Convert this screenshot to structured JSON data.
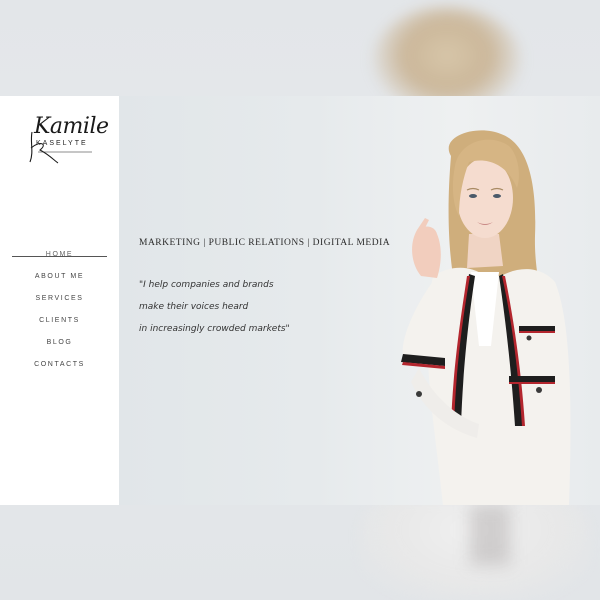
{
  "brand": {
    "script_name": "Kamile",
    "surname": "KASELYTE"
  },
  "nav": {
    "items": [
      {
        "label": "HOME",
        "active": true
      },
      {
        "label": "ABOUT ME",
        "active": false
      },
      {
        "label": "SERVICES",
        "active": false
      },
      {
        "label": "CLIENTS",
        "active": false
      },
      {
        "label": "BLOG",
        "active": false
      },
      {
        "label": "CONTACTS",
        "active": false
      }
    ]
  },
  "hero": {
    "tagline": "MARKETING | PUBLIC RELATIONS | DIGITAL MEDIA",
    "quote_lines": [
      "\"I help companies and brands",
      "make their voices heard",
      "in increasingly crowded markets\""
    ]
  },
  "colors": {
    "sidebar_bg": "#ffffff",
    "hero_bg": "#e6eaec",
    "text": "#2a2a2a",
    "jacket": "#f4f2ee",
    "trim_red": "#b3262e",
    "trim_black": "#1e1e1e",
    "hair": "#d2b486"
  }
}
